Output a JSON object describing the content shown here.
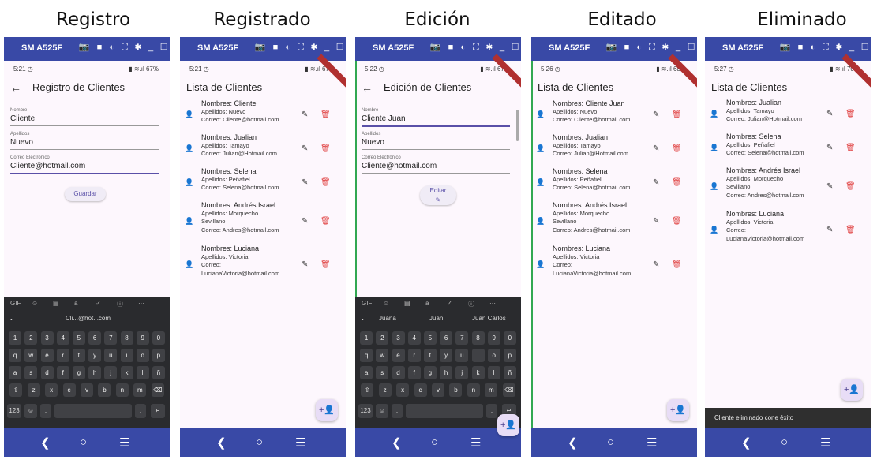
{
  "captions": [
    "Registro",
    "Registrado",
    "Edición",
    "Editado",
    "Eliminado"
  ],
  "device": {
    "name": "SM A525F",
    "tools": "📷 ■ ◐ ⛶ ✱ _ ☐"
  },
  "colors": {
    "accent": "#5a50a8",
    "titlebar": "#3949a6",
    "delete": "#e04040",
    "person": "#3b6fb5"
  },
  "nav": {
    "back": "❮",
    "home": "○",
    "menu": "☰"
  },
  "screen1": {
    "status_time": "5:21 ◷",
    "status_right": "▮ ≋.ıl 67%",
    "back": "←",
    "title": "Registro de Clientes",
    "fields": [
      {
        "label": "Nombre",
        "value": "Cliente"
      },
      {
        "label": "Apellidos",
        "value": "Nuevo"
      },
      {
        "label": "Correo Electrónico",
        "value": "Cliente@hotmail.com"
      }
    ],
    "button": "Guardar",
    "kb_tools": [
      "GIF",
      "☺",
      "▤",
      "ã",
      "✓",
      "ⓘ",
      "···"
    ],
    "kb_suggest": [
      "⌄",
      "Cli...@hot...com"
    ]
  },
  "screen2": {
    "status_time": "5:21 ◷",
    "status_right": "▮ ≋.ıl 67%",
    "title": "Lista de Clientes",
    "items": [
      {
        "name": "Nombres: Cliente",
        "l1": "Apellidos: Nuevo",
        "l2": "Correo: Cliente@hotmail.com"
      },
      {
        "name": "Nombres: Jualian",
        "l1": "Apellidos: Tamayo",
        "l2": "Correo: Julian@Hotmail.com"
      },
      {
        "name": "Nombres: Selena",
        "l1": "Apellidos: Peñafiel",
        "l2": "Correo: Selena@hotmail.com"
      },
      {
        "name": "Nombres: Andrés Israel",
        "l1": "Apellidos: Morquecho",
        "l2": "Sevillano",
        "l3": "Correo: Andres@hotmail.com"
      },
      {
        "name": "Nombres: Luciana",
        "l1": "Apellidos: Victoria",
        "l2": "Correo:",
        "l3": "LucianaVictoria@hotmail.com"
      }
    ]
  },
  "screen3": {
    "status_time": "5:22 ◷",
    "status_right": "▮ ≋.ıl 67%",
    "back": "←",
    "title": "Edición de Clientes",
    "fields": [
      {
        "label": "Nombre",
        "value": "Cliente Juan"
      },
      {
        "label": "Apellidos",
        "value": "Nuevo"
      },
      {
        "label": "Correo Electrónico",
        "value": "Cliente@hotmail.com"
      }
    ],
    "button": "Editar",
    "kb_tools": [
      "GIF",
      "☺",
      "▤",
      "ã",
      "✓",
      "ⓘ",
      "···"
    ],
    "kb_suggest": [
      "⌄",
      "Juana",
      "Juan",
      "Juan Carlos"
    ]
  },
  "screen4": {
    "status_time": "5:26 ◷",
    "status_right": "▮ ≋.ıl 68%",
    "title": "Lista de Clientes",
    "items": [
      {
        "name": "Nombres: Cliente Juan",
        "l1": "Apellidos: Nuevo",
        "l2": "Correo: Cliente@hotmail.com"
      },
      {
        "name": "Nombres: Jualian",
        "l1": "Apellidos: Tamayo",
        "l2": "Correo: Julian@Hotmail.com"
      },
      {
        "name": "Nombres: Selena",
        "l1": "Apellidos: Peñafiel",
        "l2": "Correo: Selena@hotmail.com"
      },
      {
        "name": "Nombres: Andrés Israel",
        "l1": "Apellidos: Morquecho",
        "l2": "Sevillano",
        "l3": "Correo: Andres@hotmail.com"
      },
      {
        "name": "Nombres: Luciana",
        "l1": "Apellidos: Victoria",
        "l2": "Correo:",
        "l3": "LucianaVictoria@hotmail.com"
      }
    ]
  },
  "screen5": {
    "status_time": "5:27 ◷",
    "status_right": "▮ ≋.ıl 70%",
    "title": "Lista de Clientes",
    "items": [
      {
        "name": "Nombres: Jualian",
        "l1": "Apellidos: Tamayo",
        "l2": "Correo: Julian@Hotmail.com"
      },
      {
        "name": "Nombres: Selena",
        "l1": "Apellidos: Peñafiel",
        "l2": "Correo: Selena@hotmail.com"
      },
      {
        "name": "Nombres: Andrés Israel",
        "l1": "Apellidos: Morquecho",
        "l2": "Sevillano",
        "l3": "Correo: Andres@hotmail.com"
      },
      {
        "name": "Nombres: Luciana",
        "l1": "Apellidos: Victoria",
        "l2": "Correo:",
        "l3": "LucianaVictoria@hotmail.com"
      }
    ],
    "snackbar": "Cliente eliminado cone éxito"
  },
  "keyboard": {
    "rows": [
      [
        "1",
        "2",
        "3",
        "4",
        "5",
        "6",
        "7",
        "8",
        "9",
        "0"
      ],
      [
        "q",
        "w",
        "e",
        "r",
        "t",
        "y",
        "u",
        "i",
        "o",
        "p"
      ],
      [
        "a",
        "s",
        "d",
        "f",
        "g",
        "h",
        "j",
        "k",
        "l",
        "ñ"
      ],
      [
        "⇧",
        "z",
        "x",
        "c",
        "v",
        "b",
        "n",
        "m",
        "⌫"
      ]
    ],
    "bottom": [
      "123",
      "☺",
      ",",
      "",
      ".",
      "↵"
    ]
  },
  "icons": {
    "person": "👤",
    "edit": "✎",
    "delete": "🗑",
    "fab": "+👤"
  }
}
